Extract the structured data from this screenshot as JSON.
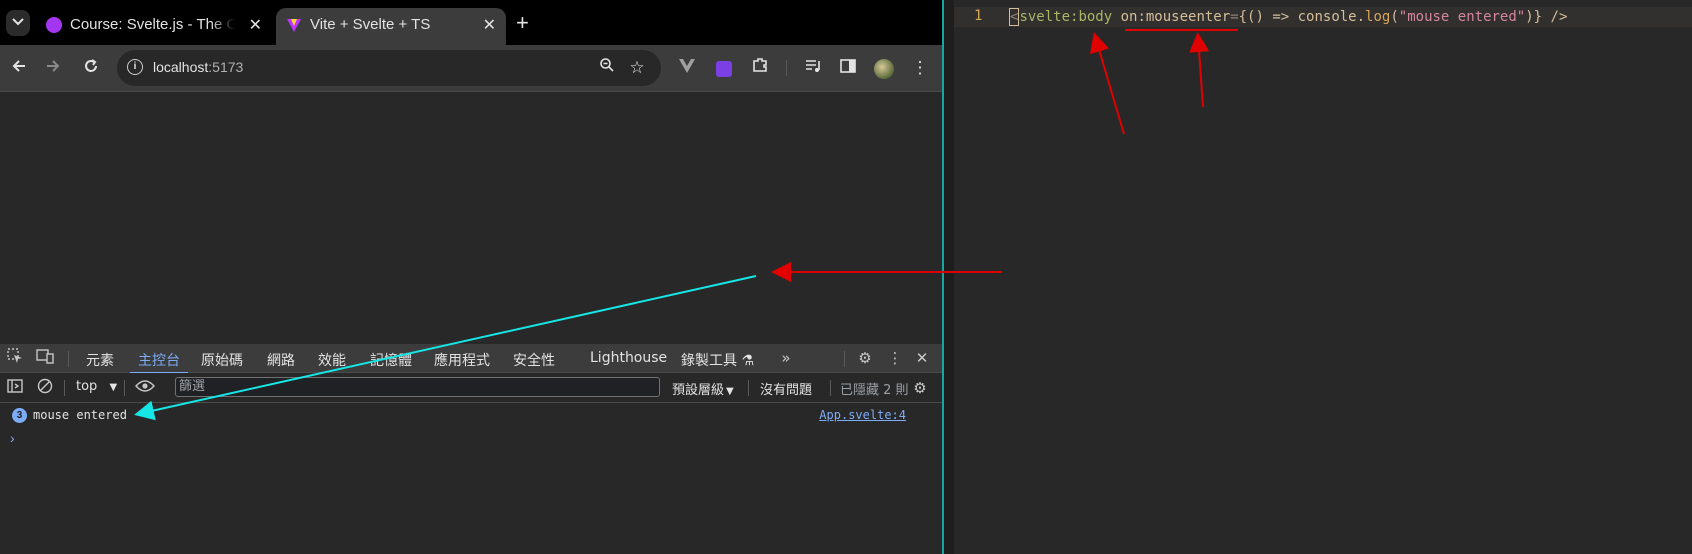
{
  "browser": {
    "tabs": [
      {
        "title": "Course: Svelte.js - The Complete Guide",
        "active": false,
        "favicon": "udemy-icon",
        "favicon_color": "#a435f0"
      },
      {
        "title": "Vite + Svelte + TS",
        "active": true,
        "favicon": "vite-icon",
        "favicon_color": "#bd34fe"
      }
    ],
    "url_host": "localhost",
    "url_port": ":5173"
  },
  "devtools": {
    "tabs": [
      "元素",
      "主控台",
      "原始碼",
      "網路",
      "效能",
      "記憶體",
      "應用程式",
      "安全性",
      "Lighthouse",
      "錄製工具 ⚗"
    ],
    "active_tab": "主控台",
    "context": "top",
    "filter_placeholder": "篩選",
    "levels": "預設層級",
    "issues": "沒有問題",
    "hidden_count": "已隱藏 2 則",
    "messages": [
      {
        "count": "3",
        "text": "mouse entered",
        "source": "App.svelte:4"
      }
    ],
    "prompt": "›"
  },
  "editor": {
    "line_number": "1",
    "code_open": "<",
    "code_tag": "svelte:body",
    "code_attr": "on:mouseenter",
    "code_eq": "=",
    "code_expr_start": "{() => console.",
    "code_fn": "log",
    "code_paren_open": "(",
    "code_str": "\"mouse entered\"",
    "code_paren_close": ")",
    "code_end": "} />"
  },
  "colors": {
    "accent": "#7cacf8",
    "annotation_red": "#e00000",
    "annotation_cyan": "#17e6e6",
    "window_border": "#1aa6a0"
  }
}
